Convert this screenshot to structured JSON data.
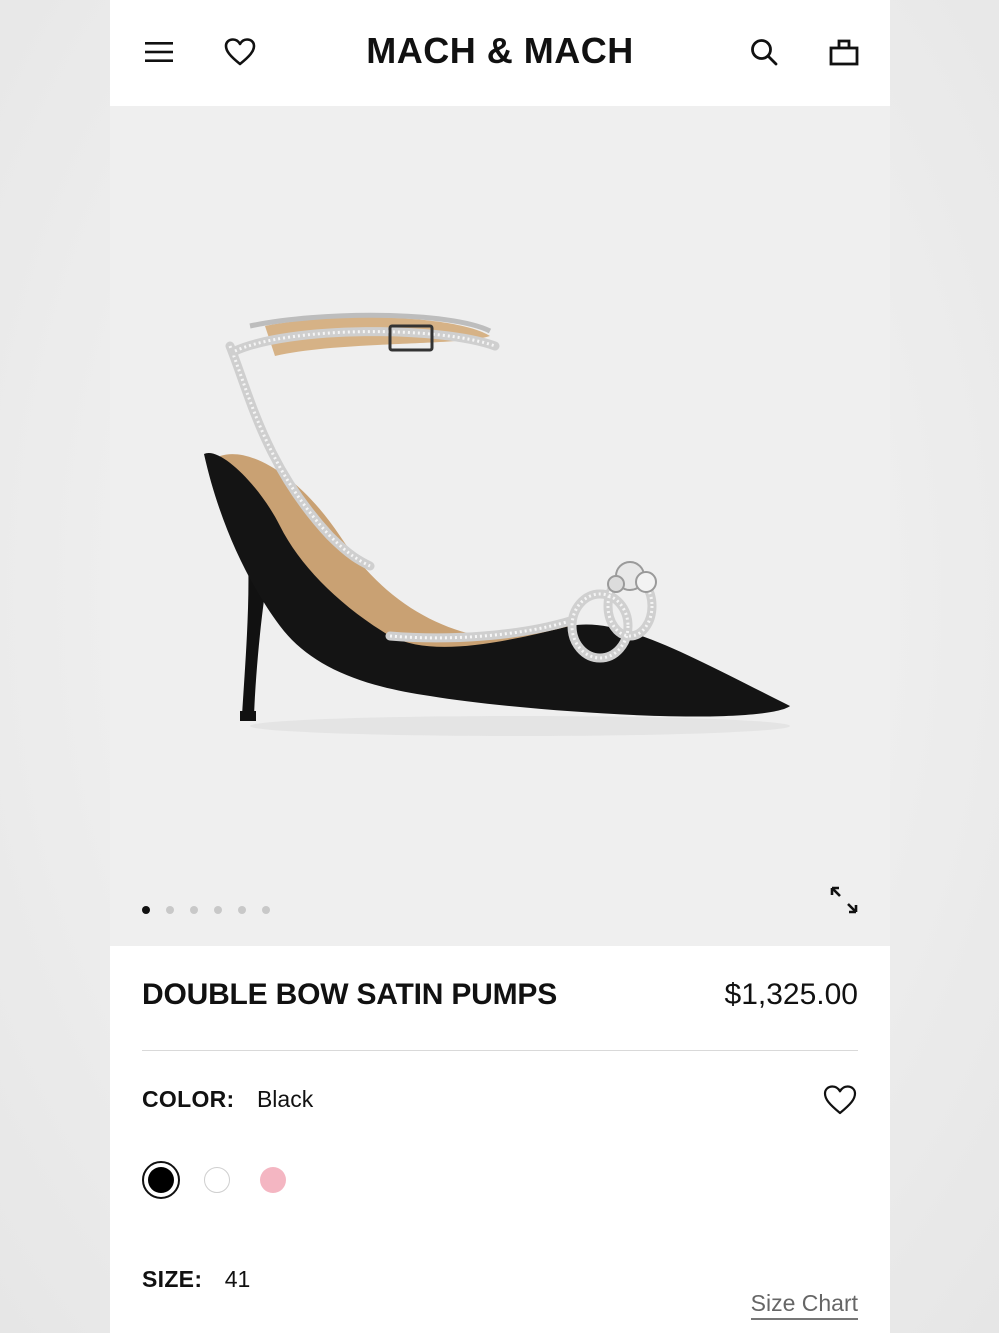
{
  "header": {
    "brand": "MACH & MACH",
    "icons": [
      "menu-icon",
      "heart-icon",
      "search-icon",
      "bag-icon"
    ]
  },
  "gallery": {
    "image_alt": "Black satin pump with crystal double bow",
    "dot_count": 6,
    "active_dot": 1
  },
  "product": {
    "title": "DOUBLE BOW SATIN PUMPS",
    "price": "$1,325.00",
    "color_label": "COLOR:",
    "color_value": "Black",
    "swatches": [
      {
        "name": "Black",
        "color": "#000000",
        "selected": true
      },
      {
        "name": "White",
        "color": "#ffffff",
        "selected": false
      },
      {
        "name": "Pink",
        "color": "#f4b6c2",
        "selected": false
      }
    ],
    "size_label": "SIZE:",
    "size_value": "41",
    "size_chart_label": "Size Chart"
  }
}
